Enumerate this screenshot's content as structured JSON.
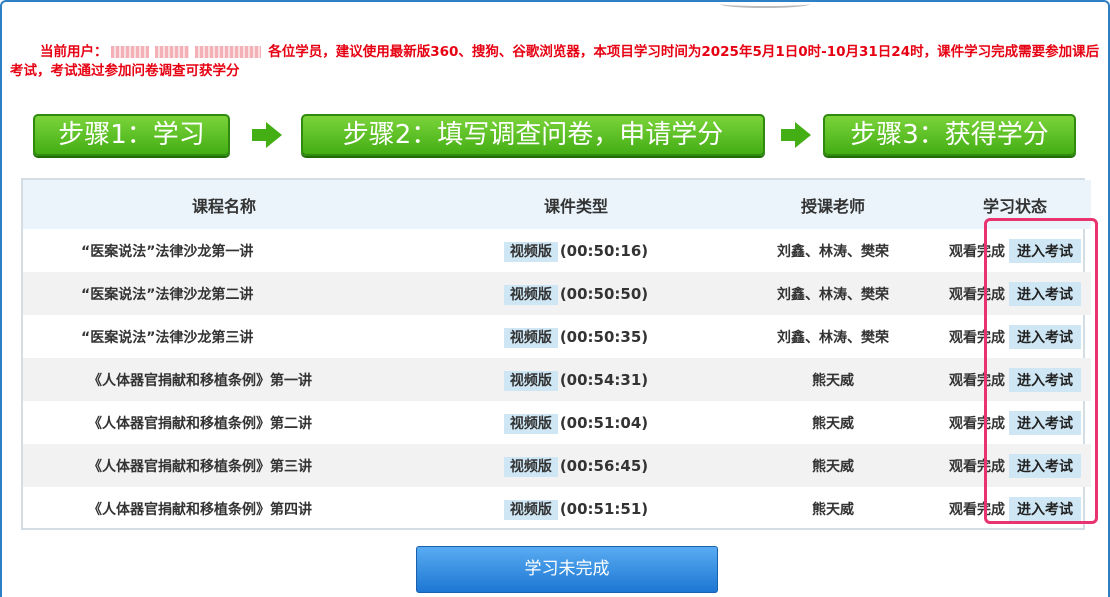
{
  "notice": {
    "user_label": "当前用户",
    "message": "各位学员，建议使用最新版360、搜狗、谷歌浏览器，本项目学习时间为2025年5月1日0时-10月31日24时，课件学习完成需要参加课后考试，考试通过参加问卷调查可获学分"
  },
  "steps": [
    {
      "label": "步骤1：学习"
    },
    {
      "label": "步骤2：填写调查问卷，申请学分"
    },
    {
      "label": "步骤3：获得学分"
    }
  ],
  "table": {
    "headers": [
      "课程名称",
      "课件类型",
      "授课老师",
      "学习状态"
    ],
    "rows": [
      {
        "course": "“医案说法”法律沙龙第一讲",
        "type": "视频版",
        "duration": "(00:50:16)",
        "teacher": "刘鑫、林涛、樊荣",
        "status": "观看完成",
        "action": "进入考试"
      },
      {
        "course": "“医案说法”法律沙龙第二讲",
        "type": "视频版",
        "duration": "(00:50:50)",
        "teacher": "刘鑫、林涛、樊荣",
        "status": "观看完成",
        "action": "进入考试"
      },
      {
        "course": "“医案说法”法律沙龙第三讲",
        "type": "视频版",
        "duration": "(00:50:35)",
        "teacher": "刘鑫、林涛、樊荣",
        "status": "观看完成",
        "action": "进入考试"
      },
      {
        "course": "《人体器官捐献和移植条例》第一讲",
        "type": "视频版",
        "duration": "(00:54:31)",
        "teacher": "熊天威",
        "status": "观看完成",
        "action": "进入考试"
      },
      {
        "course": "《人体器官捐献和移植条例》第二讲",
        "type": "视频版",
        "duration": "(00:51:04)",
        "teacher": "熊天威",
        "status": "观看完成",
        "action": "进入考试"
      },
      {
        "course": "《人体器官捐献和移植条例》第三讲",
        "type": "视频版",
        "duration": "(00:56:45)",
        "teacher": "熊天威",
        "status": "观看完成",
        "action": "进入考试"
      },
      {
        "course": "《人体器官捐献和移植条例》第四讲",
        "type": "视频版",
        "duration": "(00:51:51)",
        "teacher": "熊天威",
        "status": "观看完成",
        "action": "进入考试"
      }
    ]
  },
  "main_button": {
    "label": "学习未完成"
  },
  "colors": {
    "notice_red": "#e60012",
    "step_green": "#44ae15",
    "badge_blue": "#cfe7f5",
    "button_blue": "#1d76d2",
    "highlight_pink": "#e8336e"
  }
}
